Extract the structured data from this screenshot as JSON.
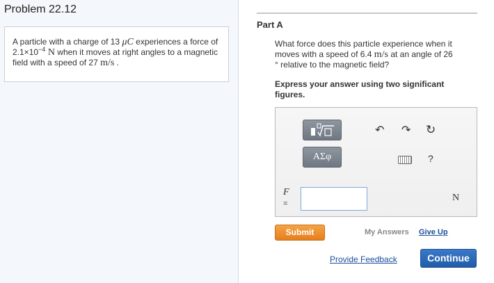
{
  "problem": {
    "title": "Problem 22.12",
    "statement": {
      "t1": "A particle with a charge of 13 ",
      "charge_unit": "μC",
      "t2": " experiences a force of 2.1×10",
      "force_exp": "−4",
      "force_unit": " N",
      "t3": " when it moves at right angles to a magnetic field with a speed of 27 ",
      "speed_unit": "m/s",
      "t4": " ."
    }
  },
  "part": {
    "title": "Part A",
    "question": {
      "q1": "What force does this particle experience when it moves with a speed of 6.4 ",
      "speed_unit": "m/s",
      "q2": " at an angle of 26",
      "degree": "°",
      "q3": " relative to the magnetic field?"
    },
    "instructions": "Express your answer using two significant figures."
  },
  "toolbar": {
    "template_label": "■√□",
    "greek_label": "ΑΣφ",
    "undo_glyph": "↶",
    "redo_glyph": "↷",
    "reset_glyph": "↻",
    "help_glyph": "?"
  },
  "answer": {
    "variable": "F",
    "equals": "=",
    "value": "",
    "unit": "N"
  },
  "actions": {
    "submit": "Submit",
    "my_answers": "My Answers",
    "give_up": "Give Up",
    "provide_feedback": "Provide Feedback",
    "continue": "Continue"
  },
  "colors": {
    "submit": "#f0922f",
    "continue": "#2d6cbc",
    "link": "#1a4f9c"
  }
}
